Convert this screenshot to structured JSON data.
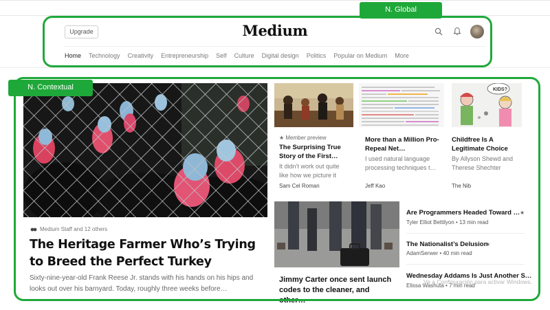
{
  "header": {
    "upgrade_label": "Upgrade",
    "logo": "Medium",
    "icons": [
      "search-icon",
      "bell-icon"
    ]
  },
  "nav": {
    "items": [
      "Home",
      "Technology",
      "Creativity",
      "Entrepreneurship",
      "Self",
      "Culture",
      "Digital design",
      "Politics",
      "Popular on Medium",
      "More"
    ],
    "active": "Home"
  },
  "annotations": {
    "global_label": "N. Global",
    "contextual_label": "N. Contextual",
    "color": "#1fa83a"
  },
  "hero": {
    "meta": "Medium Staff and 12 others",
    "title": "The Heritage Farmer Who’s Trying to Breed the Perfect Turkey",
    "description": "Sixty-nine-year-old Frank Reese Jr. stands with his hands on his hips and looks out over his barnyard. Today, roughly three weeks before…"
  },
  "cards": [
    {
      "kicker": "★ Member preview",
      "title": "The Surprising True Story of the First…",
      "description": "It didn’t work out quite like how we picture it",
      "author": "Sam Cel Roman"
    },
    {
      "title": "More than a Million Pro-Repeal Net…",
      "description": "I used natural language processing techniques t…",
      "author": "Jeff Kao"
    },
    {
      "title": "Childfree Is A Legitimate Choice",
      "description": "By Allyson Shewd and Therese Shechter",
      "author": "The Nib"
    }
  ],
  "feature": {
    "title": "Jimmy Carter once sent launch codes to the cleaner, and other…"
  },
  "list": [
    {
      "title": "Are Programmers Headed Toward …",
      "star": "★",
      "meta": "Tyler Elliot Bettilyon • 13 min read"
    },
    {
      "title": "The Nationalist’s Delusion",
      "star": "★",
      "meta": "AdamSerwer • 40 min read"
    },
    {
      "title": "Wednesday Addams Is Just Another S…",
      "star": "",
      "meta": "Elissa Washuta • 7 min read"
    }
  ],
  "watermark": "Ve a Configuración para activar Windows."
}
